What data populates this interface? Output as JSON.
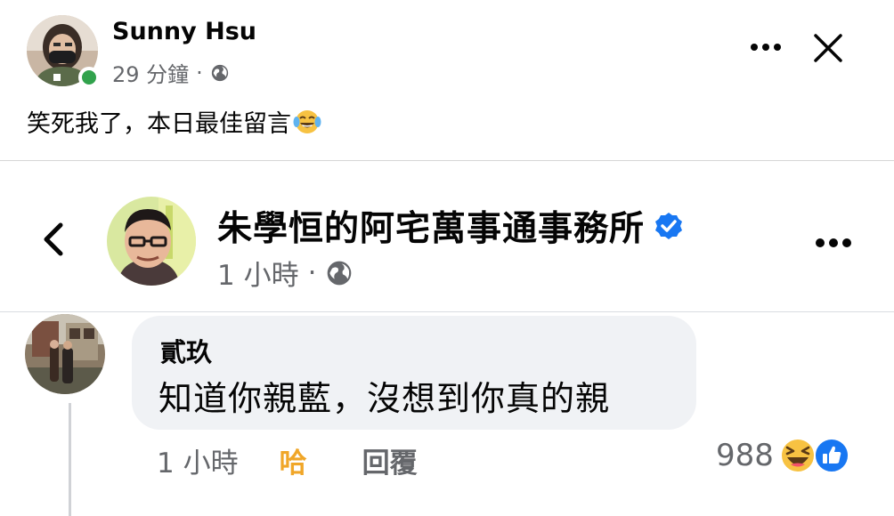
{
  "post": {
    "author": "Sunny Hsu",
    "time": "29 分鐘",
    "separator": "·",
    "privacy_icon": "globe-icon",
    "text": "笑死我了，本日最佳留言",
    "text_emoji": "face-with-tears-of-joy-emoji",
    "more_icon": "more-icon",
    "close_icon": "close-icon"
  },
  "shared": {
    "page_name": "朱學恒的阿宅萬事通事務所",
    "verified_icon": "verified-badge-icon",
    "time": "1 小時",
    "separator": "·",
    "privacy_icon": "globe-icon",
    "back_icon": "chevron-left-icon",
    "more_icon": "more-icon",
    "comment": {
      "author": "貳玖",
      "text": "知道你親藍，沒想到你真的親",
      "time": "1 小時",
      "reaction_label": "哈",
      "reply_label": "回覆",
      "reaction_count": "988",
      "reaction_icons": [
        "haha-icon",
        "like-icon"
      ]
    }
  },
  "colors": {
    "online": "#31a24c",
    "secondary_text": "#65676b",
    "haha_reaction": "#f0a628",
    "verified": "#1877f2",
    "bubble_bg": "#f0f2f5"
  }
}
